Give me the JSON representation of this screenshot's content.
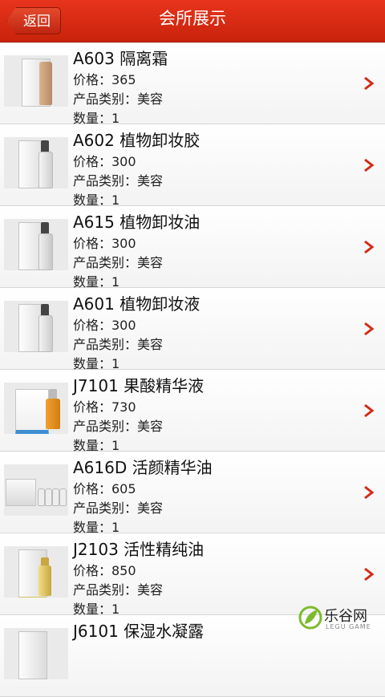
{
  "header": {
    "back_label": "返回",
    "title": "会所展示"
  },
  "items": [
    {
      "name": "A603 隔离霜",
      "price": "价格：365",
      "category": "产品类别：美容",
      "qty": "数量：1"
    },
    {
      "name": "A602 植物卸妆胶",
      "price": "价格：300",
      "category": "产品类别：美容",
      "qty": "数量：1"
    },
    {
      "name": " A615 植物卸妆油",
      "price": "价格：300",
      "category": "产品类别：美容",
      "qty": "数量：1"
    },
    {
      "name": "A601 植物卸妆液",
      "price": "价格：300",
      "category": "产品类别：美容",
      "qty": "数量：1"
    },
    {
      "name": "J7101 果酸精华液",
      "price": "价格：730",
      "category": "产品类别：美容",
      "qty": "数量：1"
    },
    {
      "name": " A616D 活颜精华油",
      "price": "价格：605",
      "category": "产品类别：美容",
      "qty": "数量：1"
    },
    {
      "name": "J2103 活性精纯油",
      "price": "价格：850",
      "category": "产品类别：美容",
      "qty": "数量：1"
    },
    {
      "name": " J6101 保湿水凝露",
      "price": "",
      "category": "",
      "qty": ""
    }
  ],
  "watermark": {
    "text": "乐谷网",
    "sub": "LEGU GAME"
  }
}
